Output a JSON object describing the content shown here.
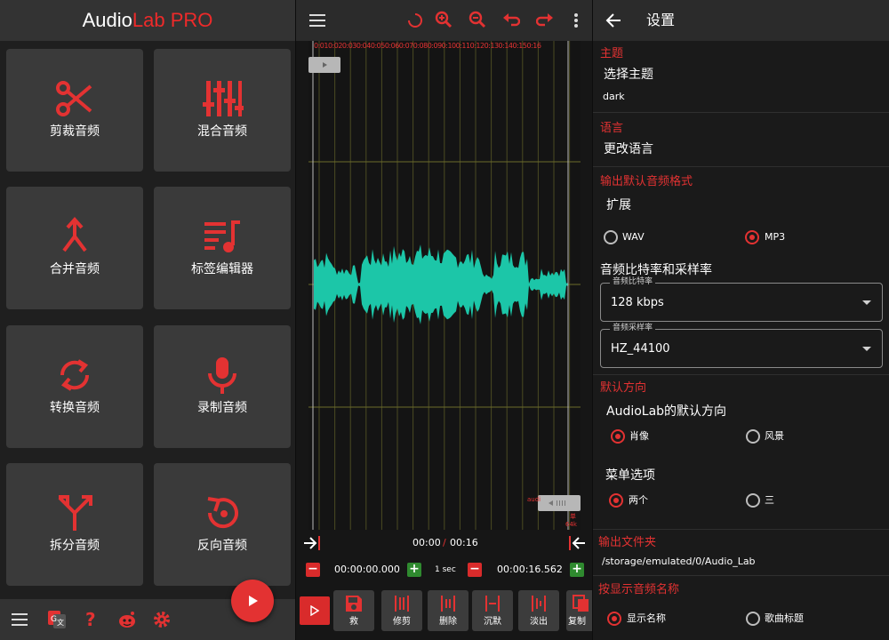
{
  "colors": {
    "accent": "#e33232",
    "waveform": "#1cc6a8",
    "tile": "#3a3a3a",
    "header": "#333333"
  },
  "home": {
    "title_part1": "Audio",
    "title_part2": "Lab PRO",
    "tiles": [
      {
        "label": "剪裁音频",
        "icon": "scissors-icon"
      },
      {
        "label": "混合音频",
        "icon": "equalizer-icon"
      },
      {
        "label": "合并音频",
        "icon": "merge-icon"
      },
      {
        "label": "标签编辑器",
        "icon": "playlist-music-icon"
      },
      {
        "label": "转换音频",
        "icon": "convert-icon"
      },
      {
        "label": "录制音频",
        "icon": "microphone-icon"
      },
      {
        "label": "拆分音频",
        "icon": "split-icon"
      },
      {
        "label": "反向音频",
        "icon": "reverse-icon"
      }
    ],
    "bottom_icons": [
      "menu-icon",
      "translate-icon",
      "help-icon",
      "reddit-icon",
      "settings-icon"
    ],
    "fab_icon": "play-icon"
  },
  "editor": {
    "toolbar_icons": [
      "menu-icon",
      "loading-icon",
      "zoom-in-icon",
      "zoom-out-icon",
      "undo-icon",
      "redo-icon",
      "more-vert-icon"
    ],
    "timeline_ticks": "0:010:020:030:040:050:060:070:080:090:100:110:120:130:140:150:16",
    "marker_label": "audi",
    "marker_label2": "单",
    "marker_bitrate": "64k",
    "current_time": "00:00",
    "time_separator": "/",
    "total_time": "00:16",
    "start_time": "00:00:00.000",
    "step": "1 sec",
    "end_time": "00:00:16.562",
    "tools": [
      {
        "label": "救",
        "icon": "save-icon"
      },
      {
        "label": "修剪",
        "icon": "trim-icon"
      },
      {
        "label": "删除",
        "icon": "delete-segment-icon"
      },
      {
        "label": "沉默",
        "icon": "silence-icon"
      },
      {
        "label": "淡出",
        "icon": "fade-out-icon"
      },
      {
        "label": "复制",
        "icon": "copy-icon"
      }
    ]
  },
  "settings": {
    "title": "设置",
    "theme": {
      "header": "主题",
      "title": "选择主题",
      "value": "dark"
    },
    "language": {
      "header": "语言",
      "title": "更改语言"
    },
    "format": {
      "header": "输出默认音频格式",
      "title": "扩展",
      "option_a": "WAV",
      "option_b": "MP3",
      "selected": "MP3"
    },
    "bitrate": {
      "header": "音频比特率和采样率",
      "bitrate_label": "音频比特率",
      "bitrate_value": "128 kbps",
      "sample_label": "音频采样率",
      "sample_value": "HZ_44100"
    },
    "orientation": {
      "header": "默认方向",
      "title": "AudioLab的默认方向",
      "option_a": "肖像",
      "option_b": "风景",
      "selected": "肖像"
    },
    "menu": {
      "title": "菜单选项",
      "option_a": "两个",
      "option_b": "三",
      "selected": "两个"
    },
    "folder": {
      "header": "输出文件夹",
      "value": "/storage/emulated/0/Audio_Lab"
    },
    "name_display": {
      "header": "按显示音频名称",
      "option_a": "显示名称",
      "option_b": "歌曲标题",
      "selected": "显示名称"
    }
  }
}
